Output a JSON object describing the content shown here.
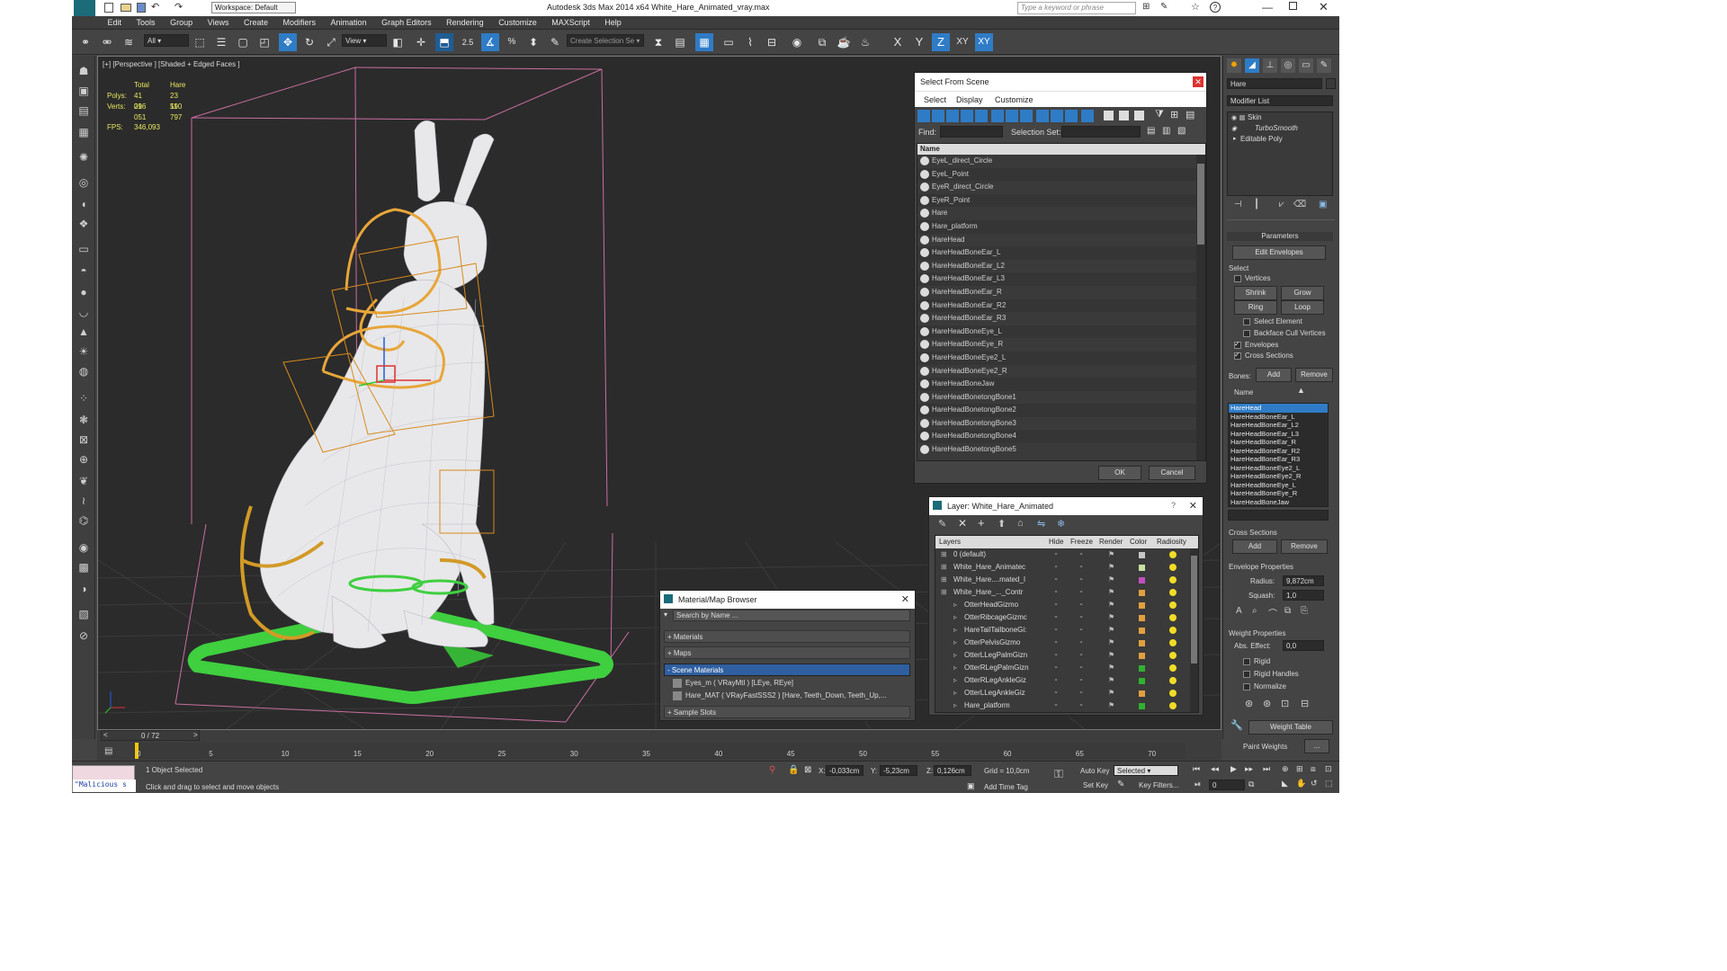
{
  "window": {
    "title": "Autodesk 3ds Max  2014 x64     White_Hare_Animated_vray.max",
    "workspace": "Workspace: Default",
    "search_placeholder": "Type a keyword or phrase"
  },
  "menu": [
    "Edit",
    "Tools",
    "Group",
    "Views",
    "Create",
    "Modifiers",
    "Animation",
    "Graph Editors",
    "Rendering",
    "Customize",
    "MAXScript",
    "Help"
  ],
  "toolbar": {
    "filter": "All",
    "ref_coord": "View",
    "snap_label": "2.5",
    "named_set_placeholder": "Create Selection Se",
    "axis_x": "X",
    "axis_y": "Y",
    "axis_z": "Z",
    "axis_xy": "XY",
    "axis_xy2": "XY"
  },
  "viewport": {
    "label": "[+] [Perspective ] [Shaded + Edged Faces ]",
    "stats": {
      "col_total": "Total",
      "col_hare": "Hare",
      "polys_label": "Polys:",
      "polys_total": "41 096",
      "polys_hare": "23 590",
      "verts_label": "Verts:",
      "verts_total": "21 051",
      "verts_hare": "11 797",
      "fps_label": "FPS:",
      "fps_value": "346,093"
    }
  },
  "select_from_scene": {
    "title": "Select From Scene",
    "menu": [
      "Select",
      "Display",
      "Customize"
    ],
    "find_label": "Find:",
    "selection_set_label": "Selection Set:",
    "column_name": "Name",
    "items": [
      "EyeL_direct_Circle",
      "EyeL_Point",
      "EyeR_direct_Circle",
      "EyeR_Point",
      "Hare",
      "Hare_platform",
      "HareHead",
      "HareHeadBoneEar_L",
      "HareHeadBoneEar_L2",
      "HareHeadBoneEar_L3",
      "HareHeadBoneEar_R",
      "HareHeadBoneEar_R2",
      "HareHeadBoneEar_R3",
      "HareHeadBoneEye_L",
      "HareHeadBoneEye_R",
      "HareHeadBoneEye2_L",
      "HareHeadBoneEye2_R",
      "HareHeadBoneJaw",
      "HareHeadBonetongBone1",
      "HareHeadBonetongBone2",
      "HareHeadBonetongBone3",
      "HareHeadBonetongBone4",
      "HareHeadBonetongBone5"
    ],
    "ok": "OK",
    "cancel": "Cancel"
  },
  "layer_dialog": {
    "title": "Layer: White_Hare_Animated",
    "help": "?",
    "columns": [
      "Layers",
      "Hide",
      "Freeze",
      "Render",
      "Color",
      "Radiosity"
    ],
    "rows": [
      {
        "name": "0 (default)",
        "indent": 0,
        "color": "#c8c8c8"
      },
      {
        "name": "White_Hare_Animatec",
        "indent": 0,
        "color": "#c8e0a0"
      },
      {
        "name": "White_Hare....mated_I",
        "indent": 0,
        "color": "#c050c0"
      },
      {
        "name": "White_Hare_..._Contr",
        "indent": 0,
        "color": "#e0a040"
      },
      {
        "name": "OtterHeadGizmo",
        "indent": 1,
        "color": "#e0a040"
      },
      {
        "name": "OtterRibcageGizmc",
        "indent": 1,
        "color": "#e0a040"
      },
      {
        "name": "HareTailTailboneGi:",
        "indent": 1,
        "color": "#e0a040"
      },
      {
        "name": "OtterPelvisGizmo",
        "indent": 1,
        "color": "#e0a040"
      },
      {
        "name": "OtterLLegPalmGizn",
        "indent": 1,
        "color": "#e0a040"
      },
      {
        "name": "OtterRLegPalmGizn",
        "indent": 1,
        "color": "#30b030"
      },
      {
        "name": "OtterRLegAnkleGiz",
        "indent": 1,
        "color": "#30b030"
      },
      {
        "name": "OtterLLegAnkleGiz",
        "indent": 1,
        "color": "#e0a040"
      },
      {
        "name": "Hare_platform",
        "indent": 1,
        "color": "#30b030"
      }
    ]
  },
  "material_browser": {
    "title": "Material/Map Browser",
    "search_placeholder": "Search by Name ...",
    "groups": [
      "+ Materials",
      "+ Maps",
      "- Scene Materials"
    ],
    "scene_materials": [
      "Eyes_m  ( VRayMtl ) [LEye, REye]",
      "Hare_MAT  ( VRayFastSSS2 ) [Hare, Teeth_Down, Teeth_Up,..."
    ],
    "sample_slots": "+ Sample Slots"
  },
  "command_panel": {
    "object_name": "Hare",
    "modifier_list": "Modifier List",
    "stack": [
      "Skin",
      "TurboSmooth",
      "Editable Poly"
    ],
    "parameters_title": "Parameters",
    "edit_envelopes": "Edit Envelopes",
    "select_label": "Select",
    "vertices": "Vertices",
    "shrink": "Shrink",
    "grow": "Grow",
    "ring": "Ring",
    "loop": "Loop",
    "select_element": "Select Element",
    "backface": "Backface Cull Vertices",
    "envelopes": "Envelopes",
    "cross_sections": "Cross Sections",
    "bones_label": "Bones:",
    "add": "Add",
    "remove": "Remove",
    "name_label": "Name",
    "bones": [
      "HareHead",
      "HareHeadBoneEar_L",
      "HareHeadBoneEar_L2",
      "HareHeadBoneEar_L3",
      "HareHeadBoneEar_R",
      "HareHeadBoneEar_R2",
      "HareHeadBoneEar_R3",
      "HareHeadBoneEye2_L",
      "HareHeadBoneEye2_R",
      "HareHeadBoneEye_L",
      "HareHeadBoneEye_R",
      "HareHeadBoneJaw"
    ],
    "cross_sections_title": "Cross Sections",
    "cs_add": "Add",
    "cs_remove": "Remove",
    "envelope_props": "Envelope Properties",
    "radius_label": "Radius:",
    "radius_value": "9,872cm",
    "squash_label": "Squash:",
    "squash_value": "1,0",
    "weight_props": "Weight Properties",
    "abs_effect_label": "Abs. Effect:",
    "abs_effect_value": "0,0",
    "rigid": "Rigid",
    "rigid_handles": "Rigid Handles",
    "normalize": "Normalize",
    "weight_table": "Weight Table",
    "paint_weights": "Paint Weights",
    "paint_dots": "..."
  },
  "timeline": {
    "frame_readout": "0 / 72",
    "ticks": [
      "0",
      "5",
      "10",
      "15",
      "20",
      "25",
      "30",
      "35",
      "40",
      "45",
      "50",
      "55",
      "60",
      "65",
      "70"
    ]
  },
  "status": {
    "maxscript": "\"Malicious s",
    "selected": "1 Object Selected",
    "prompt": "Click and drag to select and move objects",
    "x_label": "X:",
    "x_value": "-0,033cm",
    "y_label": "Y:",
    "y_value": "-5,23cm",
    "z_label": "Z:",
    "z_value": "0,126cm",
    "grid": "Grid = 10,0cm",
    "add_time_tag": "Add Time Tag",
    "auto_key": "Auto Key",
    "set_key": "Set Key",
    "selected_dropdown": "Selected",
    "key_filters": "Key Filters...",
    "current_frame": "0"
  }
}
